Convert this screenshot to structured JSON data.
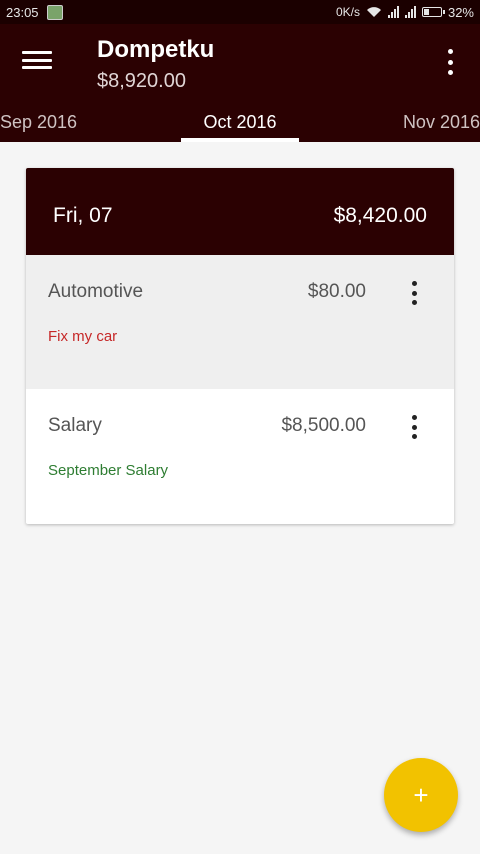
{
  "status_bar": {
    "time": "23:05",
    "net_speed": "0K/s",
    "battery": "32%",
    "battery_level": 0.32
  },
  "app_bar": {
    "title": "Dompetku",
    "balance": "$8,920.00"
  },
  "tabs": {
    "prev": "Sep 2016",
    "current": "Oct 2016",
    "next": "Nov 2016"
  },
  "day": {
    "date": "Fri, 07",
    "total": "$8,420.00",
    "transactions": [
      {
        "category": "Automotive",
        "amount": "$80.00",
        "note": "Fix my car",
        "note_color": "#c62828"
      },
      {
        "category": "Salary",
        "amount": "$8,500.00",
        "note": "September Salary",
        "note_color": "#2e7d32"
      }
    ]
  },
  "fab": {
    "icon": "+"
  },
  "colors": {
    "primary": "#2b0102",
    "accent": "#f2c200",
    "expense": "#c62828",
    "income": "#2e7d32"
  },
  "icons": {
    "menu": "hamburger-menu-icon",
    "overflow": "more-vert-icon",
    "add": "plus-icon"
  }
}
